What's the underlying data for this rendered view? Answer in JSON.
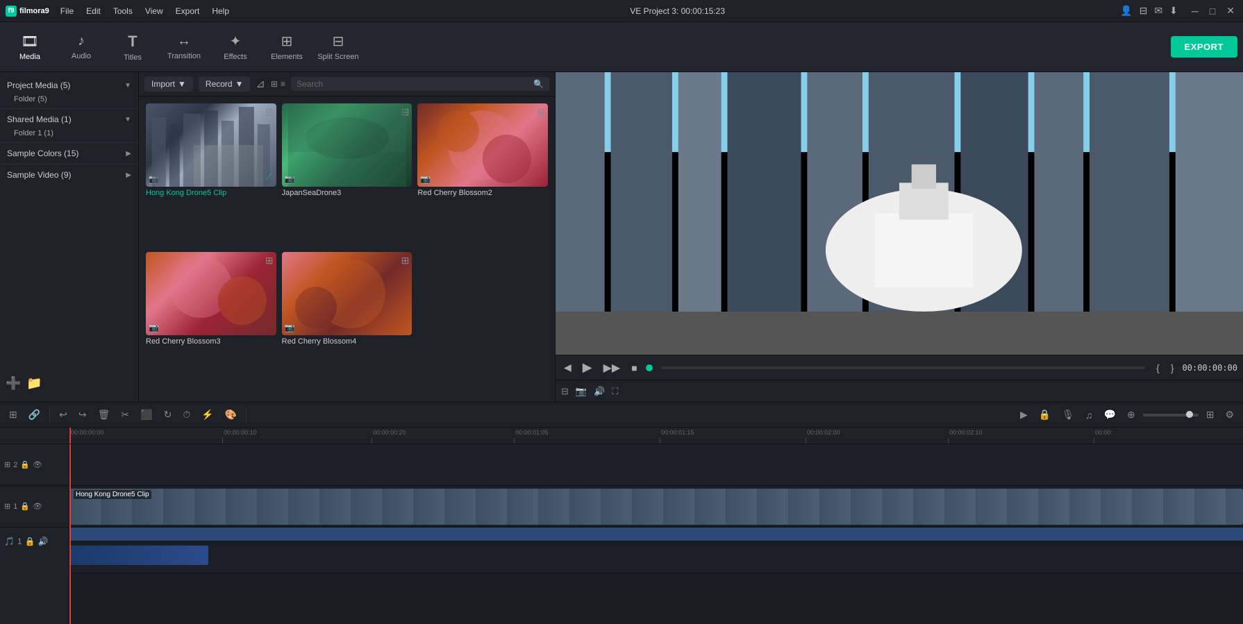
{
  "app": {
    "name": "filmora9",
    "logo_text": "f9"
  },
  "title_bar": {
    "title": "VE Project 3: 00:00:15:23",
    "menu_items": [
      "File",
      "Edit",
      "Tools",
      "View",
      "Export",
      "Help"
    ],
    "window_controls": [
      "─",
      "□",
      "✕"
    ]
  },
  "toolbar": {
    "buttons": [
      {
        "id": "media",
        "label": "Media",
        "icon": "🎞"
      },
      {
        "id": "audio",
        "label": "Audio",
        "icon": "♪"
      },
      {
        "id": "titles",
        "label": "Titles",
        "icon": "T"
      },
      {
        "id": "transition",
        "label": "Transition",
        "icon": "↔"
      },
      {
        "id": "effects",
        "label": "Effects",
        "icon": "✦"
      },
      {
        "id": "elements",
        "label": "Elements",
        "icon": "⊞"
      },
      {
        "id": "splitscreen",
        "label": "Split Screen",
        "icon": "⊟"
      }
    ],
    "export_label": "EXPORT"
  },
  "left_panel": {
    "sections": [
      {
        "title": "Project Media (5)",
        "expanded": true,
        "sub_items": [
          "Folder (5)"
        ]
      },
      {
        "title": "Shared Media (1)",
        "expanded": true,
        "sub_items": [
          "Folder 1 (1)"
        ]
      },
      {
        "title": "Sample Colors (15)",
        "expanded": false,
        "sub_items": []
      },
      {
        "title": "Sample Video (9)",
        "expanded": false,
        "sub_items": []
      }
    ],
    "bottom_buttons": [
      "add-media",
      "add-folder"
    ]
  },
  "media_panel": {
    "import_label": "Import",
    "record_label": "Record",
    "search_placeholder": "Search",
    "items": [
      {
        "id": "hk",
        "name": "Hong Kong Drone5 Clip",
        "selected": true,
        "thumb_class": "thumb-hk"
      },
      {
        "id": "japan",
        "name": "JapanSeaDrone3",
        "selected": false,
        "thumb_class": "thumb-japan"
      },
      {
        "id": "cherry1",
        "name": "Red Cherry Blossom2",
        "selected": false,
        "thumb_class": "thumb-cherry1"
      },
      {
        "id": "cherry3",
        "name": "Red Cherry Blossom3",
        "selected": false,
        "thumb_class": "thumb-cherry3"
      },
      {
        "id": "cherry4",
        "name": "Red Cherry Blossom4",
        "selected": false,
        "thumb_class": "thumb-cherry4"
      }
    ]
  },
  "preview": {
    "time_display": "00:00:00:00",
    "timecode": "00:00:15:23"
  },
  "timeline": {
    "toolbar_buttons": [
      "undo",
      "redo",
      "delete",
      "cut",
      "crop",
      "rotate",
      "speed",
      "adjust",
      "color"
    ],
    "ruler_marks": [
      "00:00:00:00",
      "00:00:00:10",
      "00:00:00:20",
      "00:00:01:05",
      "00:00:01:15",
      "00:00:02:00",
      "00:00:02:10",
      "00:00:"
    ],
    "tracks": [
      {
        "id": 2,
        "type": "video",
        "label": "2",
        "empty": true
      },
      {
        "id": 1,
        "type": "video",
        "label": "1",
        "clip": "Hong Kong Drone5 Clip"
      },
      {
        "id": "audio1",
        "type": "audio",
        "label": "1"
      }
    ],
    "zoom_level": 85
  }
}
